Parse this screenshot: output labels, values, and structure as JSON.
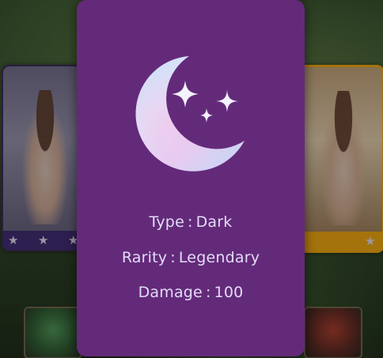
{
  "modal": {
    "icon": "crescent-moon-with-sparkles-icon",
    "background_color": "#642a7a",
    "text_color": "#e2dcf7",
    "stats": [
      {
        "label": "Type",
        "value": "Dark"
      },
      {
        "label": "Rarity",
        "value": "Legendary"
      },
      {
        "label": "Damage",
        "value": "100"
      }
    ],
    "separator": ":"
  },
  "background": {
    "left_card": {
      "rarity_stars": 3,
      "frame_color": "#3f2c6e"
    },
    "right_card": {
      "rarity_stars": 1,
      "frame_color": "#e3a011"
    }
  }
}
